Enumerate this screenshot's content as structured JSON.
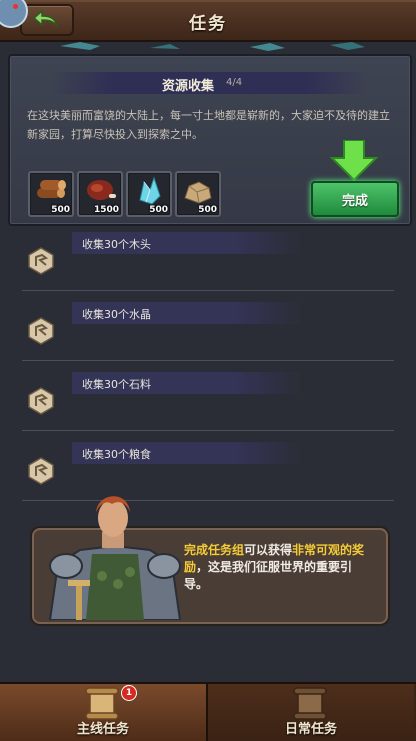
{
  "header": {
    "title": "任务"
  },
  "quest": {
    "title": "资源收集",
    "progress": "4/4",
    "description": "在这块美丽而富饶的大陆上，每一寸土地都是崭新的，大家迫不及待的建立新家园，打算尽快投入到探索之中。",
    "resources": [
      {
        "icon": "wood-log-icon",
        "count": "500"
      },
      {
        "icon": "meat-icon",
        "count": "1500"
      },
      {
        "icon": "crystal-icon",
        "count": "500"
      },
      {
        "icon": "stone-icon",
        "count": "500"
      }
    ],
    "complete_label": "完成"
  },
  "objectives": [
    {
      "label": "收集30个木头"
    },
    {
      "label": "收集30个水晶"
    },
    {
      "label": "收集30个石料"
    },
    {
      "label": "收集30个粮食"
    }
  ],
  "hint": {
    "part1": "完成任务组",
    "part2": "可以获得",
    "part3": "非常可观的奖励",
    "part4": "，这是我们征服世界的重要引导。"
  },
  "tabs": {
    "main": {
      "label": "主线任务",
      "badge": "1"
    },
    "daily": {
      "label": "日常任务"
    }
  },
  "colors": {
    "highlight": "#f5cc35",
    "complete_button": "#2fa34b"
  }
}
